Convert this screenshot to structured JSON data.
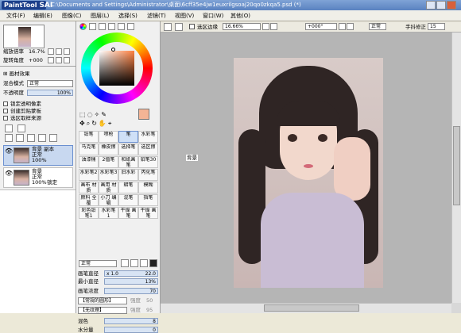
{
  "app": {
    "logo": "PaintTool",
    "logo_sai": "SAI",
    "title": "C:\\Documents and Settings\\Administrator\\桌面\\6cff35e4jw1euxrilgsoaj20qo0zkqa5.psd (*)"
  },
  "menu": [
    "文件(F)",
    "编辑(E)",
    "图像(C)",
    "图层(L)",
    "选择(S)",
    "滤镜(T)",
    "视图(V)",
    "窗口(W)",
    "其他(O)"
  ],
  "navigator": {
    "zoom_label": "缩放倍率",
    "zoom_value": "16.7%",
    "rotate_label": "旋转角度",
    "rotate_value": "+000"
  },
  "layer_effects": {
    "header": "画材效果",
    "blend_label": "混合模式",
    "blend_value": "正常",
    "opacity_label": "不透明度",
    "opacity_value": "100%",
    "checks": [
      "锁定透明像素",
      "创建剪贴蒙板",
      "选区取样来源"
    ]
  },
  "layers": [
    {
      "name": "背景 副本",
      "mode": "正常",
      "opacity": "100%",
      "extra": ""
    },
    {
      "name": "背景",
      "mode": "正常",
      "opacity": "100%",
      "extra": "锁定"
    }
  ],
  "canvas_toolbar": {
    "selection_edge": "选区边缘",
    "zoom": "16.66%",
    "angle": "+000°",
    "mode": "正常",
    "stabilizer_label": "手抖修正",
    "stabilizer_value": "15"
  },
  "canvas_label": "背景",
  "tools": {
    "brushes": [
      [
        "铅笔",
        "喷枪",
        "笔",
        "水彩笔"
      ],
      [
        "马克笔",
        "橡皮擦",
        "选择笔",
        "选区擦"
      ],
      [
        "油漆桶",
        "2值笔",
        "和纸画笔",
        "铅笔30"
      ],
      [
        "水彩笔2",
        "水彩笔3",
        "旧水彩",
        "丙化笔"
      ],
      [
        "画布 材质",
        "画用 材质",
        "蜡笔",
        "模糊"
      ],
      [
        "颜料 全覆",
        "小刀 编辑",
        "混笔",
        "指笔"
      ],
      [
        "彩色铅 笔1",
        "水彩笔 1",
        "干燥 画笔",
        "干燥 画笔"
      ]
    ],
    "brush_mode": "正常",
    "size_label": "画笔直径",
    "size_mult": "x 1.0",
    "size_value": "22.0",
    "min_size_label": "最小直径",
    "min_size_value": "13%",
    "density_label": "画笔浓度",
    "density_value": "70",
    "shape_label": "【常规的圆形】",
    "shape_strength": "强度",
    "shape_value": "50",
    "texture_label": "【无纹理】",
    "texture_strength": "强度",
    "texture_value": "95",
    "blend_label": "混色",
    "blend_value": "8",
    "water_label": "水分量",
    "water_value": "0"
  },
  "colors": {
    "foreground": "#f4b495",
    "accent": "#5a82c0"
  }
}
